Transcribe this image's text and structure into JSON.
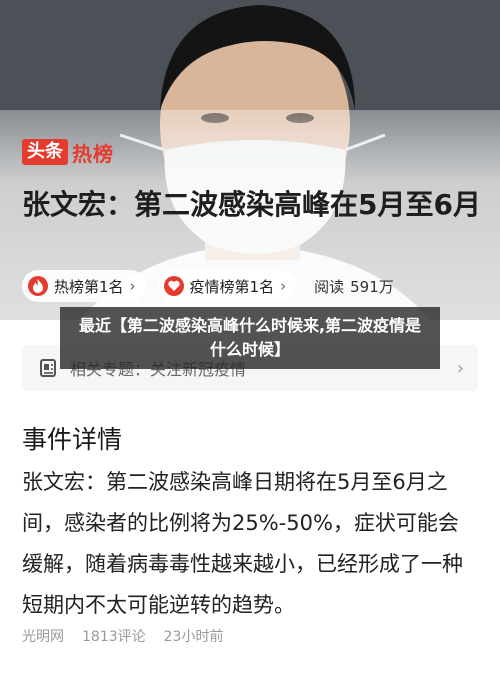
{
  "hero": {
    "brand_tag": "头条",
    "brand_text": "热榜",
    "title": "张文宏：第二波感染高峰在5月至6月",
    "pills": [
      {
        "label": "热榜第1名",
        "chevron": "›",
        "icon": "flame-icon"
      },
      {
        "label": "疫情榜第1名",
        "chevron": "›",
        "icon": "heart-shield-icon"
      }
    ],
    "reads_label": "阅读",
    "reads_value": "591万"
  },
  "caption": {
    "text": "最近【第二波感染高峰什么时候来,第二波疫情是什么时候】"
  },
  "topic": {
    "label": "相关专题：关注新冠疫情",
    "chevron": "›"
  },
  "article": {
    "heading": "事件详情",
    "body": "张文宏：第二波感染高峰日期将在5月至6月之间，感染者的比例将为25%-50%，症状可能会缓解，随着病毒毒性越来越小，已经形成了一种短期内不太可能逆转的趋势。",
    "source": "光明网",
    "comments": "1813评论",
    "time": "23小时前"
  },
  "colors": {
    "brand_red": "#e53b2f",
    "caption_bg": "#232323",
    "meta_gray": "#9a9a9a"
  }
}
